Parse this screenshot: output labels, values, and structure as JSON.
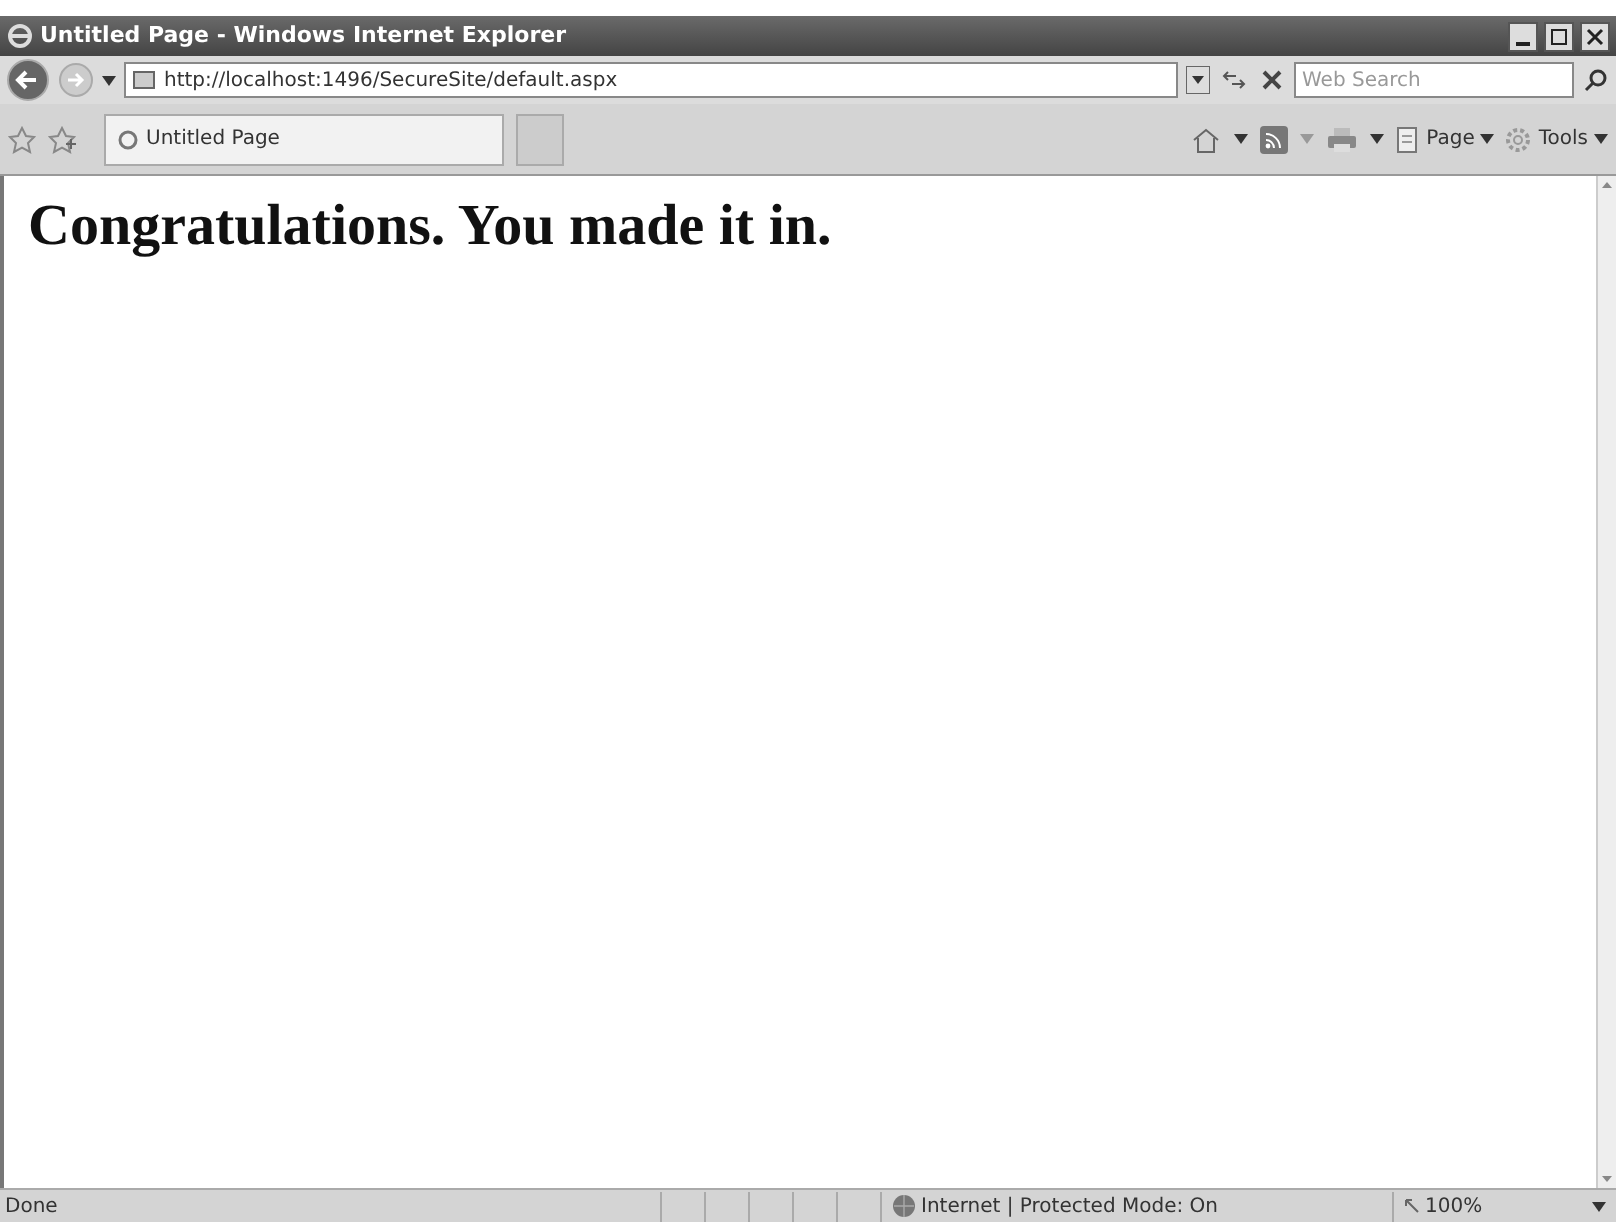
{
  "window": {
    "title": "Untitled Page - Windows Internet Explorer"
  },
  "address_bar": {
    "url": "http://localhost:1496/SecureSite/default.aspx"
  },
  "search": {
    "placeholder": "Web Search"
  },
  "tabs": [
    {
      "label": "Untitled Page",
      "selected": true
    }
  ],
  "command_bar": [
    {
      "label": "Page"
    },
    {
      "label": "Tools"
    }
  ],
  "page": {
    "heading": "Congratulations. You made it in."
  },
  "status_bar": {
    "status": "Done",
    "zone": "Internet | Protected Mode: On",
    "zoom": "100%"
  }
}
